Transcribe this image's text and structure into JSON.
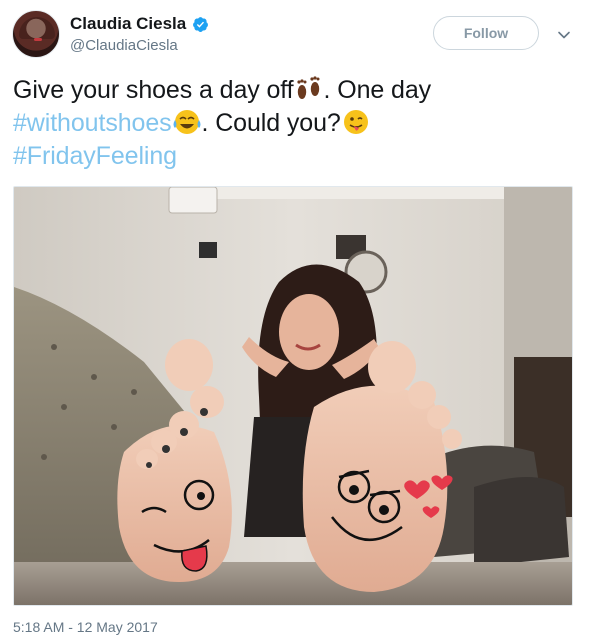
{
  "author": {
    "display_name": "Claudia Ciesla",
    "handle": "@ClaudiaCiesla",
    "verified": true,
    "avatar_icon": "profile-photo"
  },
  "actions": {
    "follow_label": "Follow",
    "menu_icon": "chevron-down-icon"
  },
  "tweet": {
    "line1_text": "Give your shoes a day off",
    "line1_emoji": "footprints-emoji",
    "line1_rest": ". One day",
    "hashtag1": "#withoutshoes",
    "line2_emoji": "tears-of-joy-emoji",
    "line2_rest": ". Could you?",
    "line2_emoji2": "tongue-out-emoji",
    "hashtag2": "#FridayFeeling"
  },
  "media": {
    "type": "photo",
    "drawings": [
      "winking-face-drawing",
      "heart-eyes-face-drawing"
    ]
  },
  "timestamp": "5:18 AM - 12 May 2017",
  "colors": {
    "link": "#1b95e0",
    "text": "#14171a",
    "muted": "#657786",
    "verified": "#1da1f2",
    "border": "#ccd6dd"
  }
}
